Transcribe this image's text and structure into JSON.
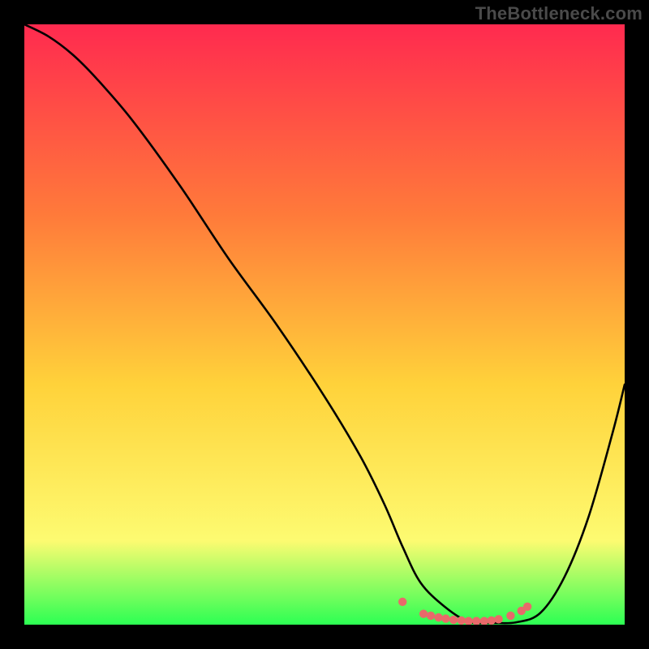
{
  "watermark": "TheBottleneck.com",
  "colors": {
    "page_bg": "#000000",
    "gradient_top": "#ff2a4f",
    "gradient_mid1": "#ff7b3a",
    "gradient_mid2": "#ffd23a",
    "gradient_mid3": "#fdfb71",
    "gradient_bottom": "#2cff53",
    "curve": "#000000",
    "marker": "#e86a6a"
  },
  "chart_data": {
    "type": "line",
    "title": "",
    "xlabel": "",
    "ylabel": "",
    "xlim": [
      0,
      100
    ],
    "ylim": [
      0,
      100
    ],
    "series": [
      {
        "name": "bottleneck-curve",
        "x": [
          0,
          4,
          8,
          12,
          18,
          26,
          34,
          42,
          50,
          56,
          60,
          63,
          66,
          70,
          74,
          78,
          82,
          86,
          90,
          94,
          98,
          100
        ],
        "values": [
          100,
          98,
          95,
          91,
          84,
          73,
          61,
          50,
          38,
          28,
          20,
          13,
          7,
          3,
          0.5,
          0.3,
          0.4,
          2,
          8,
          18,
          32,
          40
        ]
      }
    ],
    "markers": {
      "name": "highlight-dots",
      "x": [
        63.0,
        66.5,
        67.7,
        69.0,
        70.2,
        71.5,
        72.8,
        74.0,
        75.3,
        76.6,
        77.8,
        79.0,
        81.0,
        82.8,
        83.8
      ],
      "values": [
        3.8,
        1.8,
        1.5,
        1.2,
        1.0,
        0.8,
        0.7,
        0.6,
        0.6,
        0.6,
        0.7,
        0.9,
        1.5,
        2.3,
        3.0
      ]
    }
  }
}
